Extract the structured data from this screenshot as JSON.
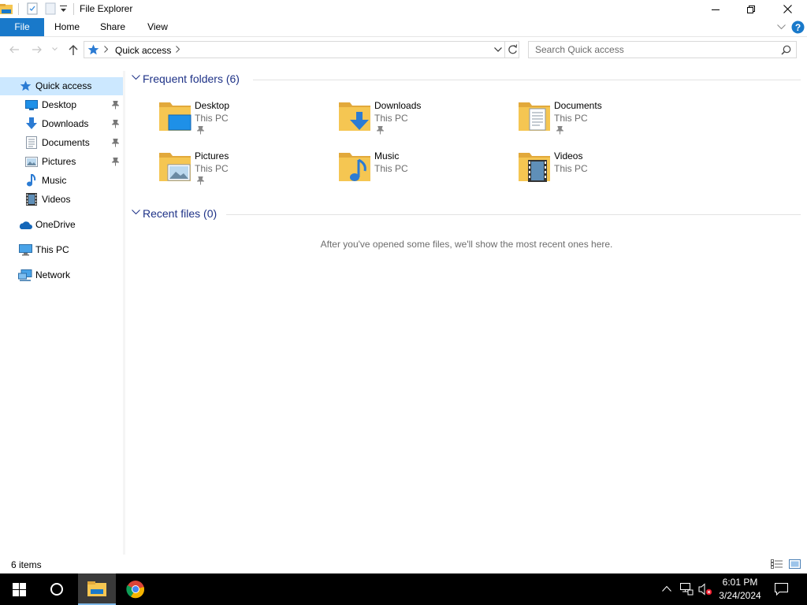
{
  "window": {
    "title": "File Explorer"
  },
  "ribbon": {
    "tabs": [
      "File",
      "Home",
      "Share",
      "View"
    ]
  },
  "address": {
    "location": "Quick access"
  },
  "search": {
    "placeholder": "Search Quick access"
  },
  "sidebar": {
    "items": [
      {
        "label": "Quick access",
        "icon": "star-icon",
        "selected": true
      },
      {
        "label": "Desktop",
        "icon": "desktop-icon",
        "pinned": true
      },
      {
        "label": "Downloads",
        "icon": "download-arrow-icon",
        "pinned": true
      },
      {
        "label": "Documents",
        "icon": "document-icon",
        "pinned": true
      },
      {
        "label": "Pictures",
        "icon": "picture-icon",
        "pinned": true
      },
      {
        "label": "Music",
        "icon": "music-note-icon"
      },
      {
        "label": "Videos",
        "icon": "film-icon"
      },
      {
        "label": "OneDrive",
        "icon": "cloud-icon"
      },
      {
        "label": "This PC",
        "icon": "monitor-icon"
      },
      {
        "label": "Network",
        "icon": "network-icon"
      }
    ]
  },
  "main": {
    "frequent": {
      "title": "Frequent folders (6)",
      "folders": [
        {
          "name": "Desktop",
          "location": "This PC",
          "pinned": true,
          "icon": "desktop-folder-icon"
        },
        {
          "name": "Downloads",
          "location": "This PC",
          "pinned": true,
          "icon": "downloads-folder-icon"
        },
        {
          "name": "Documents",
          "location": "This PC",
          "pinned": true,
          "icon": "documents-folder-icon"
        },
        {
          "name": "Pictures",
          "location": "This PC",
          "pinned": true,
          "icon": "pictures-folder-icon"
        },
        {
          "name": "Music",
          "location": "This PC",
          "pinned": false,
          "icon": "music-folder-icon"
        },
        {
          "name": "Videos",
          "location": "This PC",
          "pinned": false,
          "icon": "videos-folder-icon"
        }
      ]
    },
    "recent": {
      "title": "Recent files (0)",
      "empty_message": "After you've opened some files, we'll show the most recent ones here."
    }
  },
  "status": {
    "item_count": "6 items"
  },
  "taskbar": {
    "time": "6:01 PM",
    "date": "3/24/2024"
  },
  "colors": {
    "accent": "#1979ca",
    "selection": "#cce8ff",
    "group_title": "#1e3287",
    "folder": "#f5c652"
  }
}
